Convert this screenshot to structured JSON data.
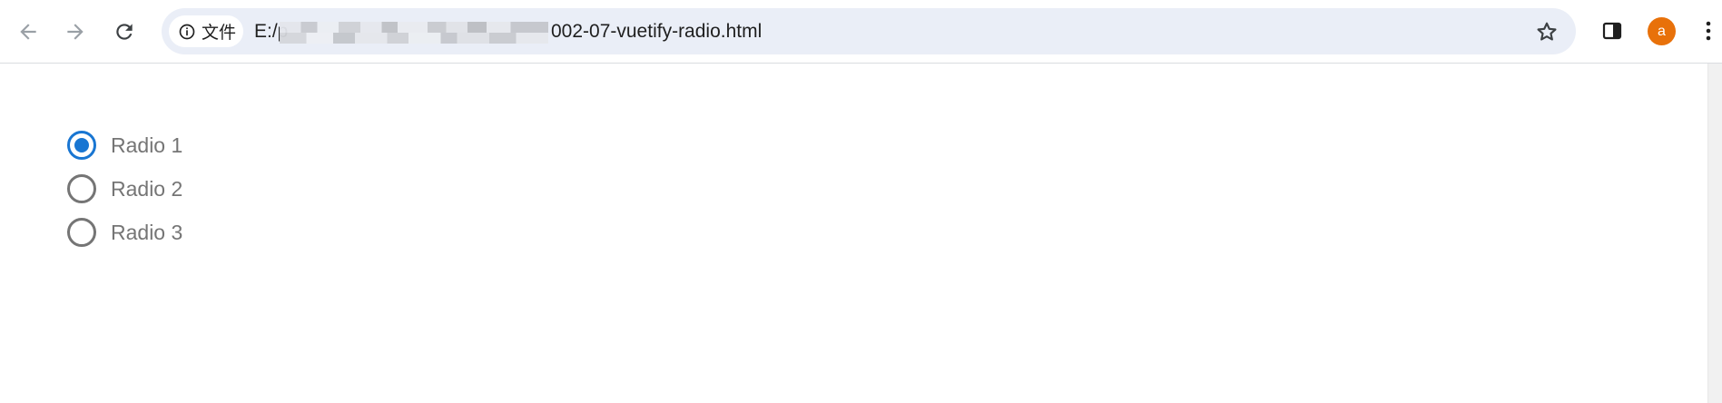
{
  "browser": {
    "site_info_label": "文件",
    "url_prefix": "E:/p",
    "url_suffix": "002-07-vuetify-radio.html",
    "profile_initial": "a",
    "colors": {
      "omnibox_bg": "#eaeef7",
      "avatar_bg": "#e8710a"
    }
  },
  "radio_group": {
    "selected_index": 0,
    "accent_color": "#1976d2",
    "options": [
      {
        "label": "Radio 1",
        "checked": true
      },
      {
        "label": "Radio 2",
        "checked": false
      },
      {
        "label": "Radio 3",
        "checked": false
      }
    ]
  }
}
